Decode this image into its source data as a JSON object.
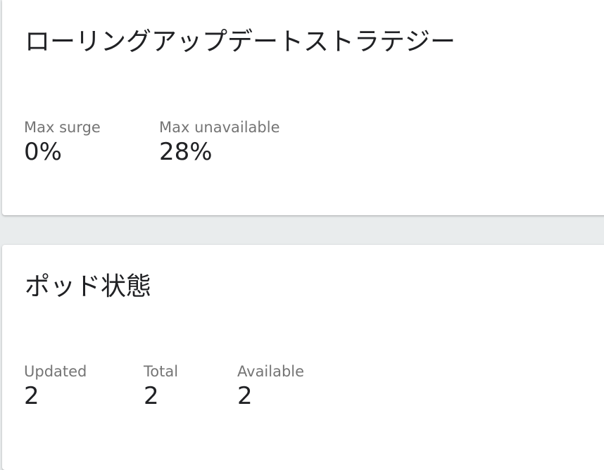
{
  "strategy_card": {
    "title": "ローリングアップデートストラテジー",
    "metrics": [
      {
        "label": "Max surge",
        "value": "0%"
      },
      {
        "label": "Max unavailable",
        "value": "28%"
      }
    ]
  },
  "pods_card": {
    "title": "ポッド状態",
    "metrics": [
      {
        "label": "Updated",
        "value": "2"
      },
      {
        "label": "Total",
        "value": "2"
      },
      {
        "label": "Available",
        "value": "2"
      }
    ]
  }
}
